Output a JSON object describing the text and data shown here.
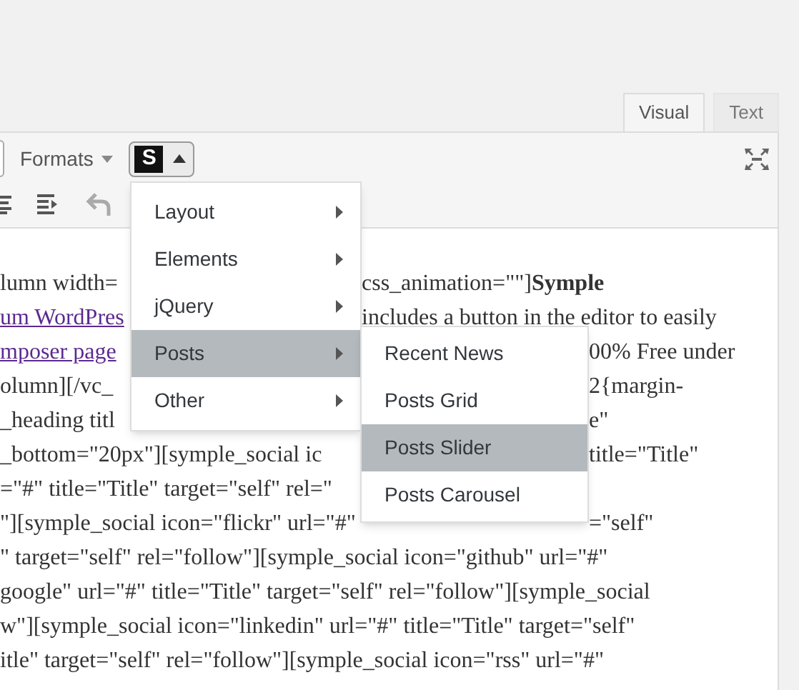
{
  "editor_tabs": [
    {
      "label": "Visual",
      "selected": true
    },
    {
      "label": "Text",
      "selected": false
    }
  ],
  "toolbar": {
    "formats_label": "Formats",
    "shortcode_button": {
      "label": "S",
      "expanded": true
    }
  },
  "menu": {
    "items": [
      {
        "label": "Layout",
        "selected": false
      },
      {
        "label": "Elements",
        "selected": false
      },
      {
        "label": "jQuery",
        "selected": false
      },
      {
        "label": "Posts",
        "selected": true
      },
      {
        "label": "Other",
        "selected": false
      }
    ]
  },
  "submenu": {
    "items": [
      {
        "label": "Recent News",
        "selected": false
      },
      {
        "label": "Posts Grid",
        "selected": false
      },
      {
        "label": "Posts Slider",
        "selected": true
      },
      {
        "label": "Posts Carousel",
        "selected": false
      }
    ]
  },
  "content_lines": [
    {
      "kind": "menu",
      "left": "lumn width=",
      "right": "css_animation=\"\"]**Symple**"
    },
    {
      "kind": "menu",
      "left": "um WordPres",
      "left_link": true,
      "right": "includes a button in the editor to easily"
    },
    {
      "kind": "both",
      "left": "mposer page",
      "left_link": true,
      "right": "00% Free under"
    },
    {
      "kind": "both",
      "left": "olumn][/vc_",
      "right": "2{margin-"
    },
    {
      "kind": "both",
      "left": "_heading titl",
      "right": "e\""
    },
    {
      "kind": "submenu",
      "left": "_bottom=\"20px\"][symple_social ic",
      "right": "title=\"Title\""
    },
    {
      "kind": "submenu",
      "left": "=\"#\" title=\"Title\" target=\"self\" rel=\""
    },
    {
      "kind": "submenu",
      "left": "\"][symple_social icon=\"flickr\" url=\"#\"",
      "right": "=\"self\""
    },
    {
      "kind": "full",
      "left": "\" target=\"self\" rel=\"follow\"][symple_social icon=\"github\" url=\"#\""
    },
    {
      "kind": "full",
      "left": "google\" url=\"#\" title=\"Title\" target=\"self\" rel=\"follow\"][symple_social"
    },
    {
      "kind": "full",
      "left": "w\"][symple_social icon=\"linkedin\" url=\"#\" title=\"Title\" target=\"self\""
    },
    {
      "kind": "full",
      "left": "itle\" target=\"self\" rel=\"follow\"][symple_social icon=\"rss\" url=\"#\""
    }
  ]
}
